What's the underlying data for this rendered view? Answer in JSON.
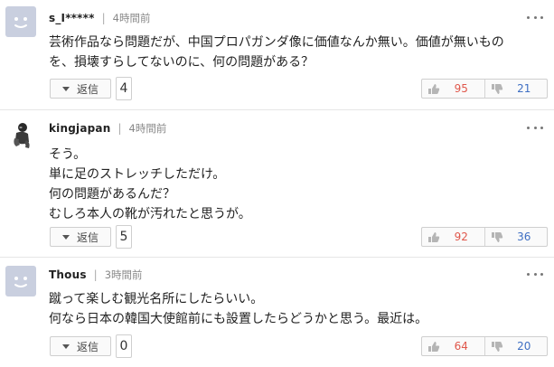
{
  "comments": [
    {
      "username": "s_I*****",
      "time": "4時間前",
      "avatar": "default-face-icon",
      "lines": [
        "芸術作品なら問題だが、中国プロパガンダ像に価値なんか無い。価値が無いもの",
        "を、損壊すらしてないのに、何の問題がある？"
      ],
      "reply_label": "返信",
      "reply_count": "4",
      "good": "95",
      "bad": "21"
    },
    {
      "username": "kingjapan",
      "time": "4時間前",
      "avatar": "figure-avatar",
      "lines": [
        "そう。",
        "単に足のストレッチしただけ。",
        "何の問題があるんだ？",
        "むしろ本人の靴が汚れたと思うが。"
      ],
      "reply_label": "返信",
      "reply_count": "5",
      "good": "92",
      "bad": "36"
    },
    {
      "username": "Thous",
      "time": "3時間前",
      "avatar": "default-face-icon",
      "lines": [
        "蹴って楽しむ観光名所にしたらいい。",
        "何なら日本の韓国大使館前にも設置したらどうかと思う。最近は。"
      ],
      "reply_label": "返信",
      "reply_count": "0",
      "good": "64",
      "bad": "20"
    }
  ],
  "colors": {
    "good": "#e0574b",
    "bad": "#3f6fc3",
    "avatar_bg": "#c9cfdf"
  }
}
